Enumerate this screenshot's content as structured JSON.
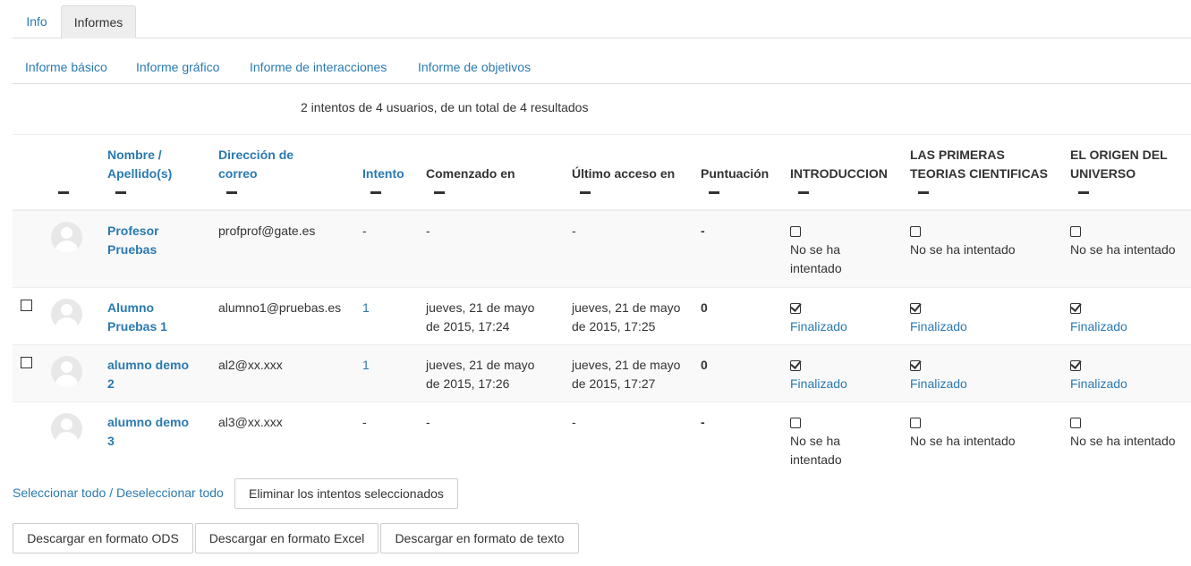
{
  "tabs": [
    {
      "label": "Info"
    },
    {
      "label": "Informes"
    }
  ],
  "subtabs": [
    {
      "label": "Informe básico"
    },
    {
      "label": "Informe gráfico"
    },
    {
      "label": "Informe de interacciones"
    },
    {
      "label": "Informe de objetivos"
    }
  ],
  "summary": "2 intentos de 4 usuarios, de un total de 4 resultados",
  "table": {
    "headers": {
      "name_line1": "Nombre /",
      "name_line2": "Apellido(s)",
      "email_line1": "Dirección de",
      "email_line2": "correo",
      "attempt": "Intento",
      "started": "Comenzado en",
      "last_access": "Último acceso en",
      "score": "Puntuación",
      "sco1": "INTRODUCCION",
      "sco2_line1": "LAS PRIMERAS",
      "sco2_line2": "TEORIAS CIENTIFICAS",
      "sco3_line1": "EL ORIGEN DEL",
      "sco3_line2": "UNIVERSO"
    },
    "rows": [
      {
        "name_line1": "Profesor",
        "name_line2": "Pruebas",
        "email": "profprof@gate.es",
        "attempt": "-",
        "started_line1": "-",
        "started_line2": "",
        "last_line1": "-",
        "last_line2": "",
        "score": "-",
        "sco1_line1": "No se ha",
        "sco1_line2": "intentado",
        "sco2": "No se ha intentado",
        "sco3": "No se ha intentado"
      },
      {
        "name_line1": "Alumno",
        "name_line2": "Pruebas 1",
        "email": "alumno1@pruebas.es",
        "attempt": "1",
        "started_line1": "jueves, 21 de mayo",
        "started_line2": "de 2015, 17:24",
        "last_line1": "jueves, 21 de mayo",
        "last_line2": "de 2015, 17:25",
        "score": "0",
        "sco1": "Finalizado",
        "sco2": "Finalizado",
        "sco3": "Finalizado"
      },
      {
        "name_line1": "alumno demo",
        "name_line2": "2",
        "email": "al2@xx.xxx",
        "attempt": "1",
        "started_line1": "jueves, 21 de mayo",
        "started_line2": "de 2015, 17:26",
        "last_line1": "jueves, 21 de mayo",
        "last_line2": "de 2015, 17:27",
        "score": "0",
        "sco1": "Finalizado",
        "sco2": "Finalizado",
        "sco3": "Finalizado"
      },
      {
        "name_line1": "alumno demo",
        "name_line2": "3",
        "email": "al3@xx.xxx",
        "attempt": "-",
        "started_line1": "-",
        "started_line2": "",
        "last_line1": "-",
        "last_line2": "",
        "score": "-",
        "sco1_line1": "No se ha",
        "sco1_line2": "intentado",
        "sco2": "No se ha intentado",
        "sco3": "No se ha intentado"
      }
    ]
  },
  "select_all": "Seleccionar todo",
  "separator": "/",
  "deselect_all": "Deseleccionar todo",
  "delete_button": "Eliminar los intentos seleccionados",
  "downloads": {
    "ods": "Descargar en formato ODS",
    "excel": "Descargar en formato Excel",
    "text": "Descargar en formato de texto"
  }
}
